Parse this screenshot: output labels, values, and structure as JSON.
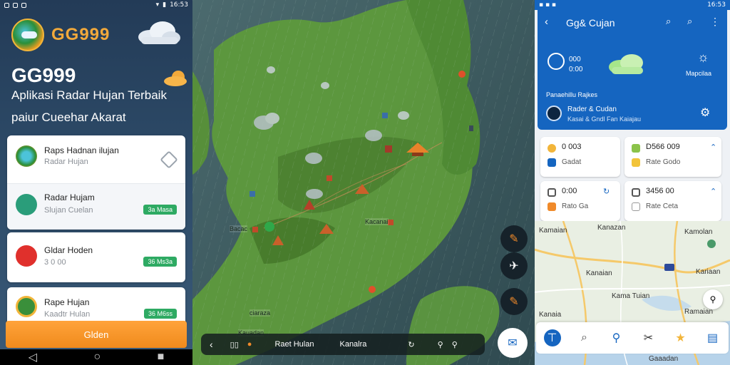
{
  "left": {
    "status_time": "16:53",
    "brand": "GG999",
    "hero_title": "GG999",
    "hero_sub1": "Aplikasi Radar Hujan Terbaik",
    "hero_sub2": "paiur Cueehar Akarat",
    "items": [
      {
        "title": "Raps Hadnan ilujan",
        "subtitle": "Radar Hujan",
        "badge": ""
      },
      {
        "title": "Radar Hujam",
        "subtitle": "Slujan Cuelan",
        "badge": "3a Masa"
      },
      {
        "title": "Gldar Hoden",
        "subtitle": "3 0 00",
        "badge": "36 Ms3a"
      },
      {
        "title": "Rape Hujan",
        "subtitle": "Kaadtr Hulan",
        "badge": "36 M6ss"
      }
    ],
    "cta_label": "Glden"
  },
  "map": {
    "labels": [
      "Bacac",
      "Kacanai",
      "ciaraza",
      "Kauadan"
    ],
    "bottom_bar": {
      "title": "Raet Hulan",
      "label": "Kanalra"
    },
    "accent": "#3f8f2f"
  },
  "right": {
    "status_time": "16:53",
    "title": "Gg& Cujan",
    "weather_value": "000",
    "weather_value2": "0:00",
    "weather_caption": "Mapcilaa",
    "section_label": "Panaehillu Rajkes",
    "row_title": "Rader & Cudan",
    "row_sub": "Kasai & Gndl Fan Kaiajau",
    "cards": [
      {
        "title": "0 003",
        "sub": "Gadat"
      },
      {
        "title": "D566 009",
        "sub": "Rate Godo"
      },
      {
        "title": "0:00",
        "sub": "Rato Ga"
      },
      {
        "title": "3456 00",
        "sub": "Rate Ceta"
      }
    ],
    "map_labels": [
      "Kamaian",
      "Kanazan",
      "Kamolan",
      "Kanaian",
      "Kariaan",
      "Kama Tuian",
      "Kanaia",
      "Ramaian",
      "Gaaadan"
    ],
    "primary_color": "#1565c0"
  }
}
